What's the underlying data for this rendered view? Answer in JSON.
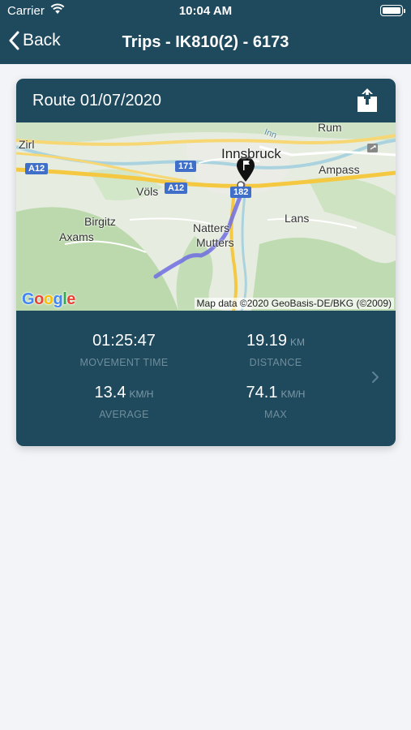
{
  "status_bar": {
    "carrier": "Carrier",
    "time": "10:04 AM"
  },
  "nav": {
    "back_label": "Back",
    "title": "Trips - IK810(2) - 6173"
  },
  "card": {
    "title": "Route 01/07/2020",
    "map": {
      "labels": {
        "rum": "Rum",
        "zirl": "Zirl",
        "innsbruck": "Innsbruck",
        "inn": "Inn",
        "ampass": "Ampass",
        "vols": "Völs",
        "birgitz": "Birgitz",
        "axams": "Axams",
        "natters": "Natters",
        "mutters": "Mutters",
        "lans": "Lans"
      },
      "shields": {
        "a12_left": "A12",
        "r171": "171",
        "a12_mid": "A12",
        "r182": "182"
      },
      "attribution": "Map data ©2020 GeoBasis-DE/BKG (©2009)",
      "logo": {
        "g": "G",
        "o1": "o",
        "o2": "o",
        "g2": "g",
        "l": "l",
        "e": "e"
      }
    },
    "stats": {
      "movement_time": {
        "value": "01:25:47",
        "label": "MOVEMENT TIME"
      },
      "distance": {
        "value": "19.19",
        "unit": "KM",
        "label": "DISTANCE"
      },
      "average": {
        "value": "13.4",
        "unit": "KM/H",
        "label": "AVERAGE"
      },
      "max": {
        "value": "74.1",
        "unit": "KM/H",
        "label": "MAX"
      }
    }
  },
  "colors": {
    "header": "#1f4a5e",
    "background": "#f2f4f7",
    "route": "#6f6ce0"
  }
}
